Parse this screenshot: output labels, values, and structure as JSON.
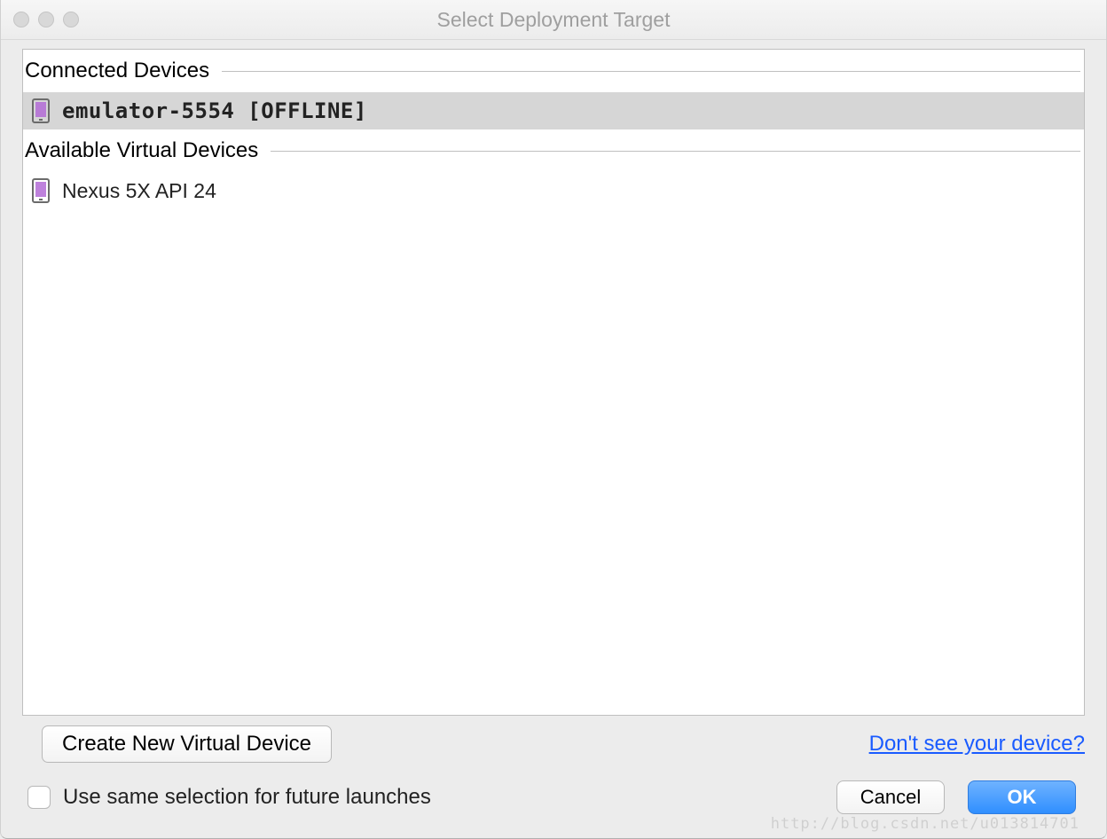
{
  "window": {
    "title": "Select Deployment Target"
  },
  "groups": {
    "connected": {
      "label": "Connected Devices"
    },
    "available": {
      "label": "Available Virtual Devices"
    }
  },
  "devices": {
    "connected": [
      {
        "name": "emulator-5554 [OFFLINE]",
        "selected": true
      }
    ],
    "available": [
      {
        "name": "Nexus 5X API 24",
        "selected": false
      }
    ]
  },
  "actions": {
    "create_new": "Create New Virtual Device",
    "help_link": "Don't see your device?",
    "use_same_label": "Use same selection for future launches",
    "cancel": "Cancel",
    "ok": "OK"
  },
  "watermark": "http://blog.csdn.net/u013814701"
}
